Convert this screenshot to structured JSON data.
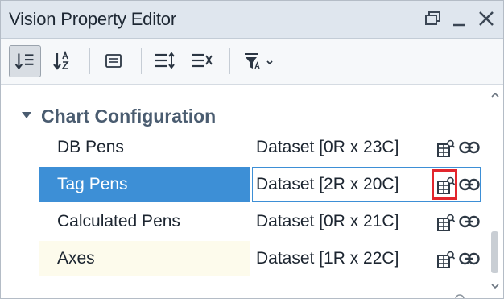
{
  "window": {
    "title": "Vision Property Editor"
  },
  "toolbar": {
    "buttons": [
      {
        "name": "sort-categorized-icon",
        "active": true
      },
      {
        "name": "sort-alphabetical-icon",
        "active": false
      },
      {
        "name": "property-description-icon",
        "active": false
      },
      {
        "name": "expand-all-icon",
        "active": false
      },
      {
        "name": "collapse-all-icon",
        "active": false
      },
      {
        "name": "filter-icon",
        "active": false
      }
    ]
  },
  "section": {
    "label": "Chart Configuration"
  },
  "rows": [
    {
      "name": "DB Pens",
      "value": "Dataset [0R x 23C]"
    },
    {
      "name": "Tag Pens",
      "value": "Dataset [2R x 20C]"
    },
    {
      "name": "Calculated Pens",
      "value": "Dataset [0R x 21C]"
    },
    {
      "name": "Axes",
      "value": "Dataset [1R x 22C]"
    }
  ],
  "colors": {
    "selection": "#3d8fd6",
    "highlight_box": "#e2262d",
    "section_label": "#4a5c70"
  }
}
